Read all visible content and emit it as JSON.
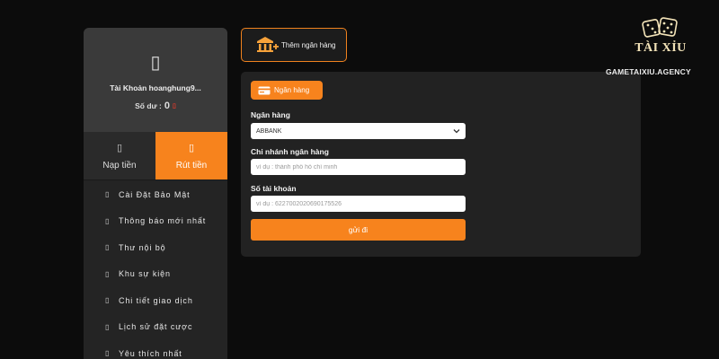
{
  "account": {
    "icon": "user-icon",
    "name": "Tài Khoản hoanghung9...",
    "balance_label": "Số dư :",
    "balance_value": "0"
  },
  "tabs": [
    {
      "label": "Nạp tiền",
      "icon": "deposit-icon",
      "active": false
    },
    {
      "label": "Rút tiền",
      "icon": "withdraw-icon",
      "active": true
    }
  ],
  "menu": [
    {
      "label": "Cài Đặt Bảo Mật",
      "icon": "lock-icon"
    },
    {
      "label": "Thông báo mới nhất",
      "icon": "bell-icon"
    },
    {
      "label": "Thư nội bộ",
      "icon": "mail-icon"
    },
    {
      "label": "Khu sự kiện",
      "icon": "gift-icon"
    },
    {
      "label": "Chi tiết giao dịch",
      "icon": "list-icon"
    },
    {
      "label": "Lịch sử đặt cược",
      "icon": "history-icon"
    },
    {
      "label": "Yêu thích nhất",
      "icon": "heart-icon"
    }
  ],
  "add_bank": {
    "label": "Thêm ngân hàng",
    "icon": "bank-add-icon"
  },
  "form": {
    "pill_label": "Ngân hàng",
    "pill_icon": "card-icon",
    "bank_label": "Ngân hàng",
    "bank_value": "ABBANK",
    "branch_label": "Chi nhánh ngân hàng",
    "branch_placeholder": "ví dụ : thành phố hồ chí minh",
    "account_label": "Số tài khoản",
    "account_placeholder": "ví dụ : 6227002020690175526",
    "submit_label": "gửi đi"
  },
  "logo": {
    "title": "TÀI XỈU",
    "subtitle": "GAMETAIXIU.AGENCY"
  },
  "colors": {
    "accent": "#f7831d",
    "sidebar": "#242424",
    "account_bg": "#3a3a3a",
    "panel": "#222222",
    "page_bg": "#0c0c0c",
    "logo_gold": "#f3e3b8"
  }
}
